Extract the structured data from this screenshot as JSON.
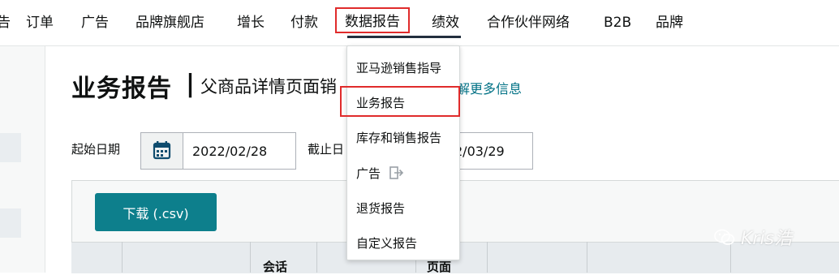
{
  "nav": {
    "items": [
      "告",
      "订单",
      "广告",
      "品牌旗舰店",
      "增长",
      "付款",
      "数据报告",
      "绩效",
      "合作伙伴网络",
      "B2B",
      "品牌"
    ]
  },
  "dropdown": {
    "items": [
      "亚马逊销售指导",
      "业务报告",
      "库存和销售报告",
      "广告",
      "退货报告",
      "自定义报告"
    ]
  },
  "page": {
    "title": "业务报告",
    "separator": "|",
    "subtitle": "父商品详情页面销",
    "learn_more": "解更多信息"
  },
  "filters": {
    "start_label": "起始日期",
    "start_value": "2022/02/28",
    "end_label": "截止日",
    "end_value": "2/03/29"
  },
  "panel": {
    "download_label": "下载 (.csv)",
    "headers": [
      "会话",
      "页面"
    ]
  },
  "watermark": "Kris浩",
  "colors": {
    "accent": "#0d7f8c",
    "highlight": "#e02b2b",
    "link": "#007185"
  }
}
